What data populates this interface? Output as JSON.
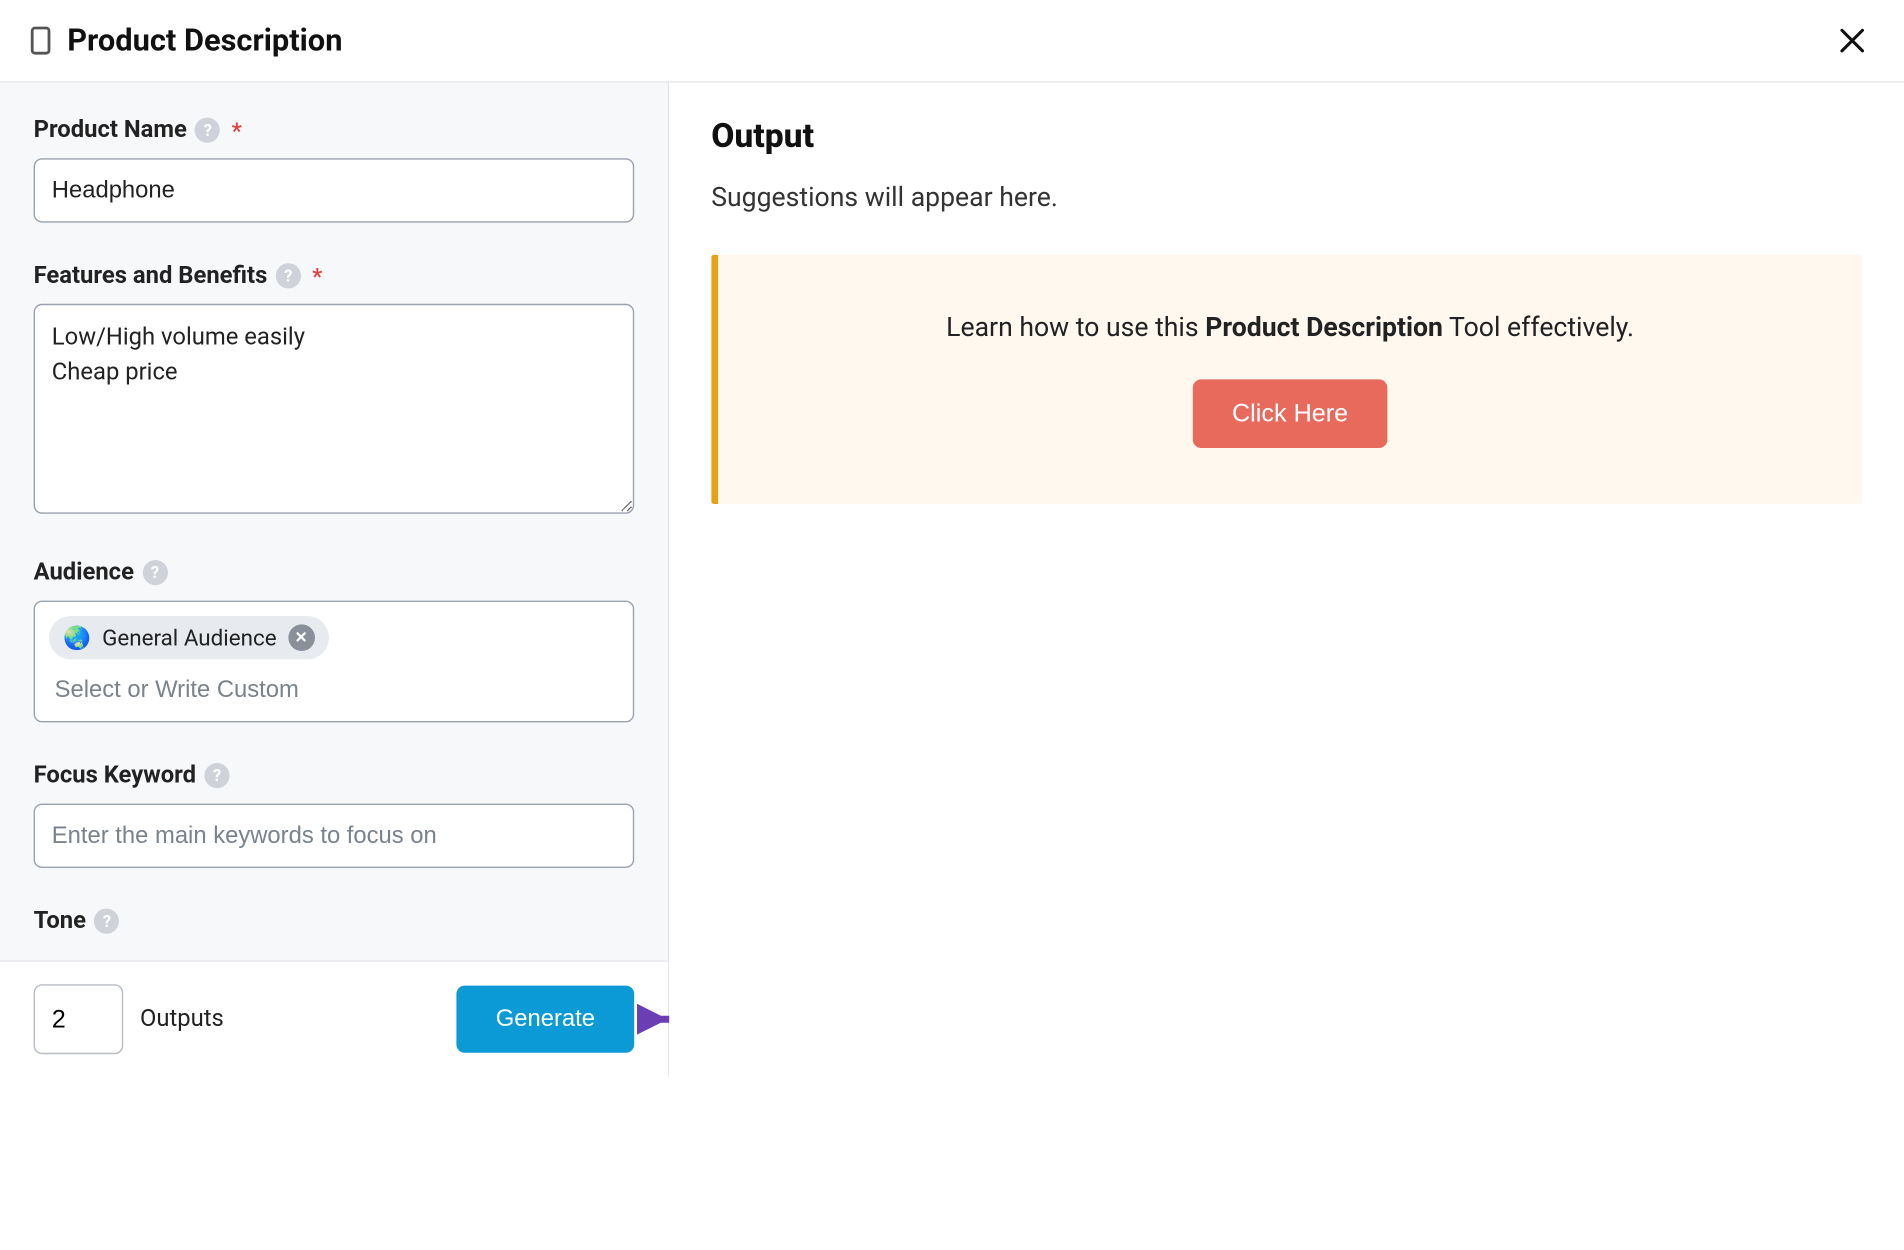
{
  "header": {
    "title": "Product Description"
  },
  "form": {
    "product_name": {
      "label": "Product Name",
      "value": "Headphone",
      "required": true
    },
    "features": {
      "label": "Features and Benefits",
      "value": "Low/High volume easily\nCheap price",
      "required": true
    },
    "audience": {
      "label": "Audience",
      "chip_icon": "🌏",
      "chip_label": "General Audience",
      "placeholder": "Select or Write Custom"
    },
    "focus_keyword": {
      "label": "Focus Keyword",
      "placeholder": "Enter the main keywords to focus on"
    },
    "tone": {
      "label": "Tone"
    }
  },
  "footer": {
    "outputs_value": "2",
    "outputs_label": "Outputs",
    "generate_label": "Generate"
  },
  "output": {
    "title": "Output",
    "subtitle": "Suggestions will appear here.",
    "tip_prefix": "Learn how to use this ",
    "tip_bold": "Product Description",
    "tip_suffix": " Tool effectively.",
    "tip_button": "Click Here"
  }
}
